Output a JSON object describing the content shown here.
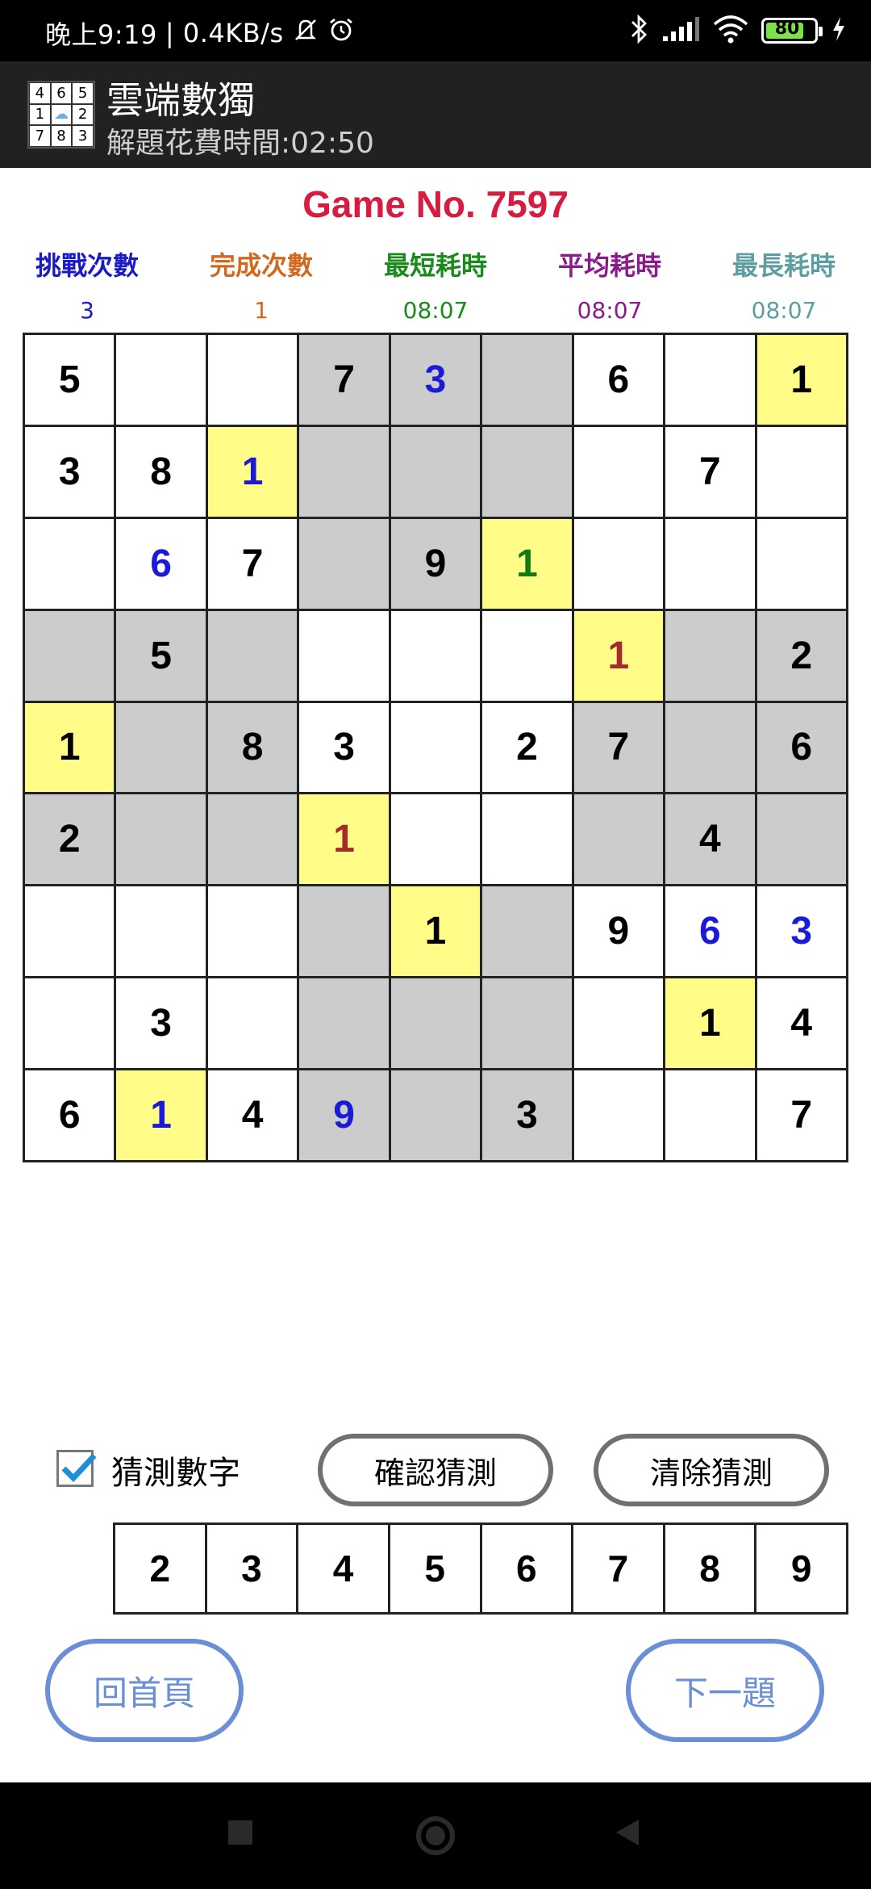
{
  "status_bar": {
    "time": "晚上9:19",
    "network_speed": "| 0.4KB/s",
    "battery_level": "80",
    "icons": [
      "mute-icon",
      "alarm-icon",
      "bluetooth-icon",
      "signal-icon",
      "wifi-icon",
      "battery-icon",
      "charging-icon"
    ]
  },
  "app_bar": {
    "logo_digits": [
      "4",
      "6",
      "5",
      "1",
      "☁",
      "2",
      "7",
      "8",
      "3"
    ],
    "title": "雲端數獨",
    "subtitle": "解題花費時間:02:50"
  },
  "game": {
    "title": "Game No. 7597",
    "title_color": "#d81b40"
  },
  "stats": [
    {
      "label": "挑戰次數",
      "value": "3",
      "color": "#1a1ac8"
    },
    {
      "label": "完成次數",
      "value": "1",
      "color": "#d2691e"
    },
    {
      "label": "最短耗時",
      "value": "08:07",
      "color": "#1a8a1a"
    },
    {
      "label": "平均耗時",
      "value": "08:07",
      "color": "#8b1a8b"
    },
    {
      "label": "最長耗時",
      "value": "08:07",
      "color": "#5f9ea0"
    }
  ],
  "board": {
    "colors": {
      "given": "#000000",
      "entered_blue": "#1a1ad8",
      "entered_green": "#127a12",
      "entered_red": "#a52a2a",
      "gray": "#cccccc",
      "highlight": "#fffd88"
    },
    "cells": [
      [
        {
          "v": "5",
          "bg": "w",
          "c": "k"
        },
        {
          "v": "",
          "bg": "w",
          "c": "k"
        },
        {
          "v": "",
          "bg": "w",
          "c": "k"
        },
        {
          "v": "7",
          "bg": "g",
          "c": "k"
        },
        {
          "v": "3",
          "bg": "g",
          "c": "b"
        },
        {
          "v": "",
          "bg": "g",
          "c": "k"
        },
        {
          "v": "6",
          "bg": "w",
          "c": "k"
        },
        {
          "v": "",
          "bg": "w",
          "c": "k"
        },
        {
          "v": "1",
          "bg": "y",
          "c": "k"
        }
      ],
      [
        {
          "v": "3",
          "bg": "w",
          "c": "k"
        },
        {
          "v": "8",
          "bg": "w",
          "c": "k"
        },
        {
          "v": "1",
          "bg": "y",
          "c": "b"
        },
        {
          "v": "",
          "bg": "g",
          "c": "k"
        },
        {
          "v": "",
          "bg": "g",
          "c": "k"
        },
        {
          "v": "",
          "bg": "g",
          "c": "k"
        },
        {
          "v": "",
          "bg": "w",
          "c": "k"
        },
        {
          "v": "7",
          "bg": "w",
          "c": "k"
        },
        {
          "v": "",
          "bg": "w",
          "c": "k"
        }
      ],
      [
        {
          "v": "",
          "bg": "w",
          "c": "k"
        },
        {
          "v": "6",
          "bg": "w",
          "c": "b"
        },
        {
          "v": "7",
          "bg": "w",
          "c": "k"
        },
        {
          "v": "",
          "bg": "g",
          "c": "k"
        },
        {
          "v": "9",
          "bg": "g",
          "c": "k"
        },
        {
          "v": "1",
          "bg": "y",
          "c": "gr"
        },
        {
          "v": "",
          "bg": "w",
          "c": "k"
        },
        {
          "v": "",
          "bg": "w",
          "c": "k"
        },
        {
          "v": "",
          "bg": "w",
          "c": "k"
        }
      ],
      [
        {
          "v": "",
          "bg": "g",
          "c": "k"
        },
        {
          "v": "5",
          "bg": "g",
          "c": "k"
        },
        {
          "v": "",
          "bg": "g",
          "c": "k"
        },
        {
          "v": "",
          "bg": "w",
          "c": "k"
        },
        {
          "v": "",
          "bg": "w",
          "c": "k"
        },
        {
          "v": "",
          "bg": "w",
          "c": "k"
        },
        {
          "v": "1",
          "bg": "y",
          "c": "r"
        },
        {
          "v": "",
          "bg": "g",
          "c": "k"
        },
        {
          "v": "2",
          "bg": "g",
          "c": "k"
        }
      ],
      [
        {
          "v": "1",
          "bg": "y",
          "c": "k"
        },
        {
          "v": "",
          "bg": "g",
          "c": "k"
        },
        {
          "v": "8",
          "bg": "g",
          "c": "k"
        },
        {
          "v": "3",
          "bg": "w",
          "c": "k"
        },
        {
          "v": "",
          "bg": "w",
          "c": "k"
        },
        {
          "v": "2",
          "bg": "w",
          "c": "k"
        },
        {
          "v": "7",
          "bg": "g",
          "c": "k"
        },
        {
          "v": "",
          "bg": "g",
          "c": "k"
        },
        {
          "v": "6",
          "bg": "g",
          "c": "k"
        }
      ],
      [
        {
          "v": "2",
          "bg": "g",
          "c": "k"
        },
        {
          "v": "",
          "bg": "g",
          "c": "k"
        },
        {
          "v": "",
          "bg": "g",
          "c": "k"
        },
        {
          "v": "1",
          "bg": "y",
          "c": "r"
        },
        {
          "v": "",
          "bg": "w",
          "c": "k"
        },
        {
          "v": "",
          "bg": "w",
          "c": "k"
        },
        {
          "v": "",
          "bg": "g",
          "c": "k"
        },
        {
          "v": "4",
          "bg": "g",
          "c": "k"
        },
        {
          "v": "",
          "bg": "g",
          "c": "k"
        }
      ],
      [
        {
          "v": "",
          "bg": "w",
          "c": "k"
        },
        {
          "v": "",
          "bg": "w",
          "c": "k"
        },
        {
          "v": "",
          "bg": "w",
          "c": "k"
        },
        {
          "v": "",
          "bg": "g",
          "c": "k"
        },
        {
          "v": "1",
          "bg": "y",
          "c": "k"
        },
        {
          "v": "",
          "bg": "g",
          "c": "k"
        },
        {
          "v": "9",
          "bg": "w",
          "c": "k"
        },
        {
          "v": "6",
          "bg": "w",
          "c": "b"
        },
        {
          "v": "3",
          "bg": "w",
          "c": "b"
        }
      ],
      [
        {
          "v": "",
          "bg": "w",
          "c": "k"
        },
        {
          "v": "3",
          "bg": "w",
          "c": "k"
        },
        {
          "v": "",
          "bg": "w",
          "c": "k"
        },
        {
          "v": "",
          "bg": "g",
          "c": "k"
        },
        {
          "v": "",
          "bg": "g",
          "c": "k"
        },
        {
          "v": "",
          "bg": "g",
          "c": "k"
        },
        {
          "v": "",
          "bg": "w",
          "c": "k"
        },
        {
          "v": "1",
          "bg": "y",
          "c": "k"
        },
        {
          "v": "4",
          "bg": "w",
          "c": "k"
        }
      ],
      [
        {
          "v": "6",
          "bg": "w",
          "c": "k"
        },
        {
          "v": "1",
          "bg": "y",
          "c": "b"
        },
        {
          "v": "4",
          "bg": "w",
          "c": "k"
        },
        {
          "v": "9",
          "bg": "g",
          "c": "b"
        },
        {
          "v": "",
          "bg": "g",
          "c": "k"
        },
        {
          "v": "3",
          "bg": "g",
          "c": "k"
        },
        {
          "v": "",
          "bg": "w",
          "c": "k"
        },
        {
          "v": "",
          "bg": "w",
          "c": "k"
        },
        {
          "v": "7",
          "bg": "w",
          "c": "k"
        }
      ]
    ]
  },
  "guess": {
    "checkbox_label": "猜測數字",
    "checked": true,
    "confirm_label": "確認猜測",
    "clear_label": "清除猜測"
  },
  "numpad": [
    "2",
    "3",
    "4",
    "5",
    "6",
    "7",
    "8",
    "9"
  ],
  "nav": {
    "home_label": "回首頁",
    "next_label": "下一題",
    "accent": "#6b8fd6"
  }
}
